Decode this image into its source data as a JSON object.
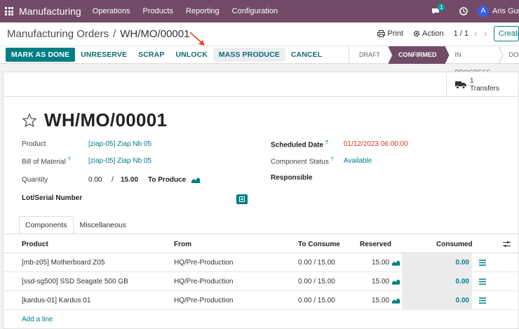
{
  "navbar": {
    "app_name": "Manufacturing",
    "menus": [
      "Operations",
      "Products",
      "Reporting",
      "Configuration"
    ],
    "chat_badge": "1",
    "avatar_initial": "A",
    "user_name": "Aris Gunt"
  },
  "control_panel": {
    "breadcrumb_parent": "Manufacturing Orders",
    "breadcrumb_sep": "/",
    "breadcrumb_current": "WH/MO/00001",
    "print_label": "Print",
    "action_label": "Action",
    "pager": "1 / 1",
    "pager_prev": "‹",
    "pager_next": "›",
    "create_label": "Create"
  },
  "actions": {
    "mark_as_done": "MARK AS DONE",
    "unreserve": "UNRESERVE",
    "scrap": "SCRAP",
    "unlock": "UNLOCK",
    "mass_produce": "MASS PRODUCE",
    "cancel": "CANCEL"
  },
  "stages": {
    "draft": "DRAFT",
    "confirmed": "CONFIRMED",
    "in_progress": "IN PROGRESS",
    "done": "DONE"
  },
  "smart_button": {
    "count": "1",
    "label": "Transfers"
  },
  "record": {
    "title": "WH/MO/00001",
    "product_label": "Product",
    "product_value": "[ziap-05] Ziap Nb 05",
    "bom_label": "Bill of Material",
    "bom_value": "[ziap-05] Ziap Nb 05",
    "quantity_label": "Quantity",
    "quantity_done": "0.00",
    "quantity_sep": "/",
    "quantity_total": "15.00",
    "to_produce_label": "To Produce",
    "lot_label": "Lot/Serial Number",
    "scheduled_label": "Scheduled Date",
    "scheduled_value": "01/12/2023 06:00:00",
    "component_status_label": "Component Status",
    "component_status_value": "Available",
    "responsible_label": "Responsible",
    "help_mark": "?"
  },
  "tabs": {
    "components": "Components",
    "misc": "Miscellaneous"
  },
  "table": {
    "headers": {
      "product": "Product",
      "from": "From",
      "to_consume": "To Consume",
      "reserved": "Reserved",
      "consumed": "Consumed"
    },
    "rows": [
      {
        "product": "[mb-z05] Motherboard Z05",
        "from": "HQ/Pre-Production",
        "to_consume": "0.00 /  15.00",
        "reserved": "15.00",
        "consumed": "0.00"
      },
      {
        "product": "[ssd-sg500] SSD Seagate 500 GB",
        "from": "HQ/Pre-Production",
        "to_consume": "0.00 /  15.00",
        "reserved": "15.00",
        "consumed": "0.00"
      },
      {
        "product": "[kardus-01] Kardus 01",
        "from": "HQ/Pre-Production",
        "to_consume": "0.00 /  15.00",
        "reserved": "15.00",
        "consumed": "0.00"
      }
    ],
    "add_line": "Add a line"
  },
  "colors": {
    "brand": "#714b67",
    "accent": "#017e84",
    "danger": "#d9342b"
  },
  "icons": [
    "apps-grid-icon",
    "chat-icon",
    "clock-icon",
    "printer-icon",
    "gear-icon",
    "truck-icon",
    "star-icon",
    "forecast-chart-icon",
    "list-icon",
    "optional-columns-icon",
    "plus-icon",
    "arrow-annotation-icon"
  ]
}
